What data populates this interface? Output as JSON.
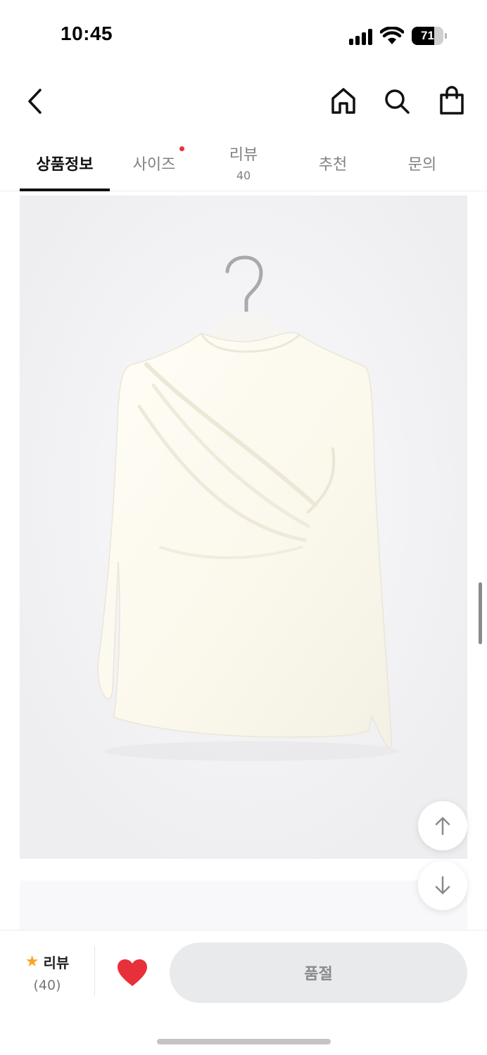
{
  "status_bar": {
    "time": "10:45",
    "battery": "71",
    "battery_level": 0.71
  },
  "nav": {
    "back_icon": "chevron-left-icon",
    "home_icon": "home-icon",
    "search_icon": "search-icon",
    "cart_icon": "shopping-bag-icon"
  },
  "tabs": [
    {
      "label": "상품정보",
      "active": true
    },
    {
      "label": "사이즈",
      "has_dot": true
    },
    {
      "label": "리뷰",
      "count": "40"
    },
    {
      "label": "추천"
    },
    {
      "label": "문의"
    }
  ],
  "product_image": {
    "description_icon": "product-photo",
    "bg_color": "#eeedf0"
  },
  "float_buttons": {
    "up_icon": "arrow-up-icon",
    "down_icon": "arrow-down-icon"
  },
  "bottom_bar": {
    "review_label": "리뷰",
    "review_count": "(40)",
    "heart_icon": "heart-icon",
    "soldout_label": "품절"
  },
  "colors": {
    "accent_red": "#e8303a",
    "star": "#f6a623",
    "tab_dot": "#e8303a"
  }
}
